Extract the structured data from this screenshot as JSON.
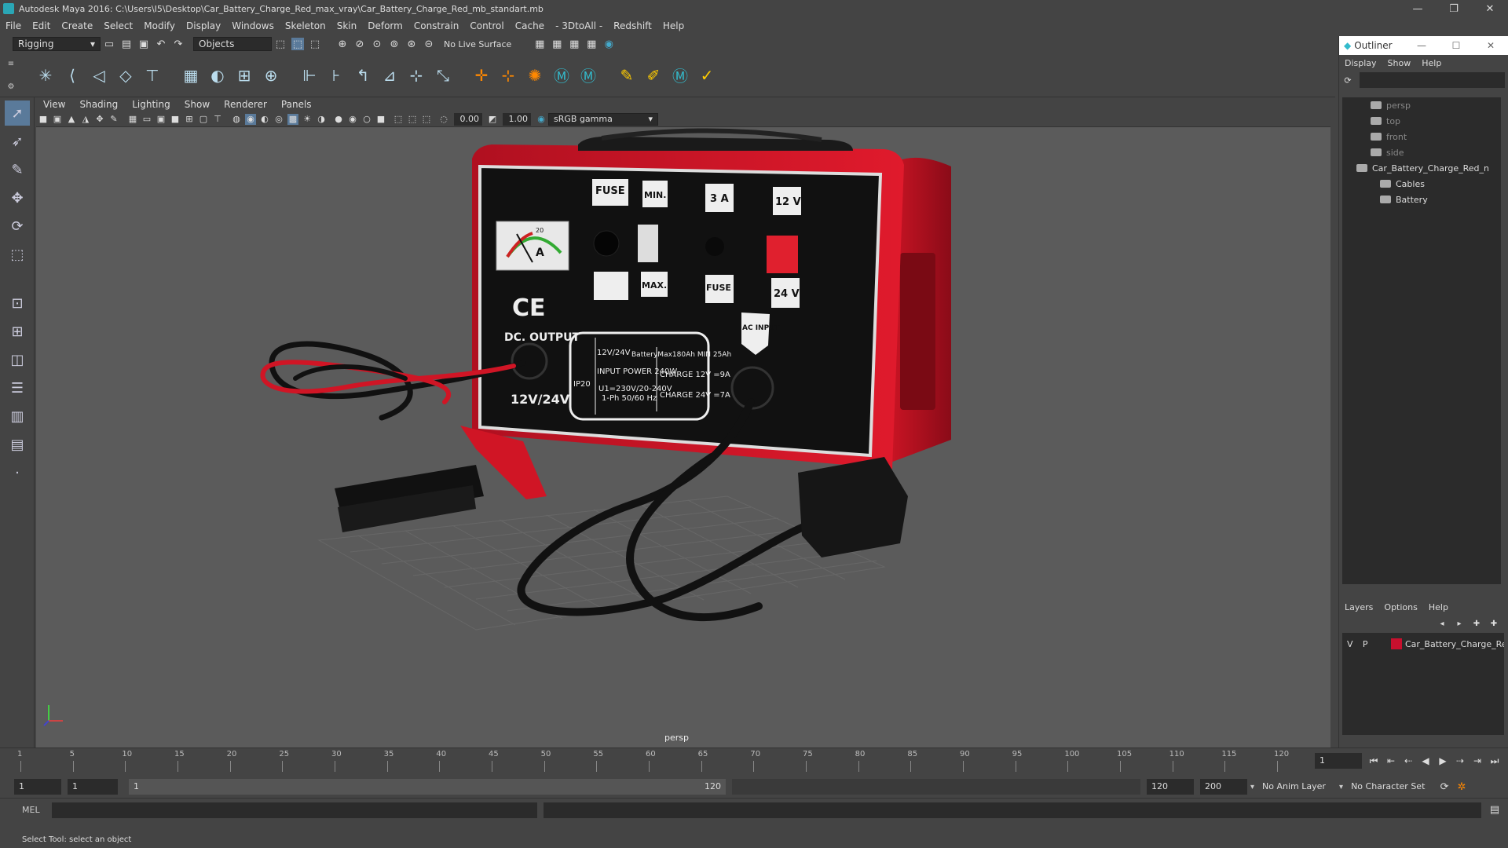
{
  "window": {
    "title": "Autodesk Maya 2016: C:\\Users\\I5\\Desktop\\Car_Battery_Charge_Red_max_vray\\Car_Battery_Charge_Red_mb_standart.mb"
  },
  "menubar": [
    "File",
    "Edit",
    "Create",
    "Select",
    "Modify",
    "Display",
    "Windows",
    "Skeleton",
    "Skin",
    "Deform",
    "Constrain",
    "Control",
    "Cache",
    "- 3DtoAll -",
    "Redshift",
    "Help"
  ],
  "shelf": {
    "mode": "Rigging",
    "selection_mode": "Objects",
    "live_surface": "No Live Surface"
  },
  "viewport": {
    "menu": [
      "View",
      "Shading",
      "Lighting",
      "Show",
      "Renderer",
      "Panels"
    ],
    "near_value": "0.00",
    "far_value": "1.00",
    "color_space": "sRGB gamma",
    "camera_label": "persp"
  },
  "charger": {
    "panel_labels": [
      "FUSE",
      "MIN.",
      "3 A",
      "12 V",
      "MAX.",
      "FUSE",
      "24 V"
    ],
    "dc_output": "DC. OUTPUT",
    "ce": "CE",
    "ac_input": "AC INPUT",
    "output_voltage": "12V/24V",
    "gauge_letter": "A",
    "gauge_mark": "20",
    "plate_lines": [
      "12V/24V",
      "BatteryMax180Ah MIN 25Ah",
      "INPUT POWER 240W",
      "CHARGE 12V =9A",
      "U1=230V/20-240V",
      "1-Ph 50/60 Hz",
      "CHARGE 24V =7A",
      "IP20"
    ]
  },
  "outliner": {
    "title": "Outliner",
    "menu": [
      "Display",
      "Show",
      "Help"
    ],
    "items": [
      {
        "label": "persp",
        "dim": true
      },
      {
        "label": "top",
        "dim": true
      },
      {
        "label": "front",
        "dim": true
      },
      {
        "label": "side",
        "dim": true
      },
      {
        "label": "Car_Battery_Charge_Red_n",
        "dim": false
      },
      {
        "label": "Cables",
        "dim": false
      },
      {
        "label": "Battery",
        "dim": false
      }
    ]
  },
  "layers": {
    "menu": [
      "Layers",
      "Options",
      "Help"
    ],
    "row": {
      "v": "V",
      "p": "P",
      "name": "Car_Battery_Charge_Re",
      "color": "#c8102e"
    }
  },
  "timeline": {
    "ticks": [
      "1",
      "5",
      "10",
      "15",
      "20",
      "25",
      "30",
      "35",
      "40",
      "45",
      "50",
      "55",
      "60",
      "65",
      "70",
      "75",
      "80",
      "85",
      "90",
      "95",
      "100",
      "105",
      "110",
      "115",
      "120"
    ],
    "current_frame": "1"
  },
  "range": {
    "start": "1",
    "playback_start": "1",
    "slider_start": "1",
    "slider_end": "120",
    "playback_end": "120",
    "end": "200",
    "anim_layer": "No Anim Layer",
    "char_set": "No Character Set"
  },
  "command_line": {
    "label": "MEL"
  },
  "status": {
    "message": "Select Tool: select an object"
  }
}
